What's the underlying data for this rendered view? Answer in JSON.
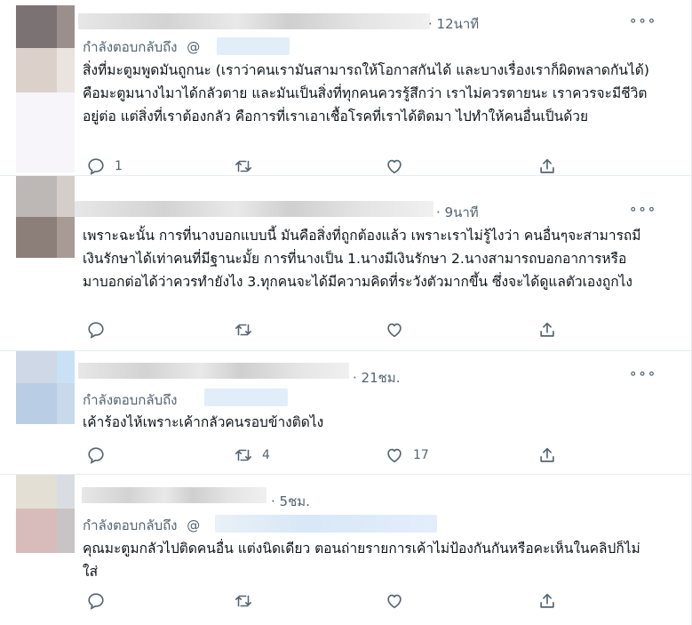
{
  "tweets": [
    {
      "time": "· 12นาที",
      "reply_label": "กำลังตอบกลับถึง",
      "reply_mention": "@",
      "text": "สิ่งที่มะตูมพูดมันถูกนะ (เราว่าคนเรามันสามารถให้โอกาสกันได้ และบางเรื่องเราก็ผิดพลาดกันได้) คือมะตูมนางไมาได้กลัวตาย และมันเป็นสิ่งที่ทุกคนควรรู้สึกว่า เราไม่ควรตายนะ เราควรจะมีชีวิตอยู่ต่อ แต่สิ่งที่เราต้องกลัว คือการที่เราเอาเชื้อโรคที่เราได้ติดมา ไปทำให้คนอื่นเป็นด้วย",
      "reply_count": "1",
      "retweet_count": "",
      "like_count": ""
    },
    {
      "time": "· 9นาที",
      "reply_label": "",
      "reply_mention": "",
      "text": "เพราะฉะนั้น การที่นางบอกแบบนี้ มันคือสิ่งที่ถูกต้องแล้ว เพราะเราไม่รู้ไงว่า คนอื่นๆจะสามารถมีเงินรักษาได้เท่าคนที่มีฐานะมั้ย การที่นางเป็น 1.นางมีเงินรักษา 2.นางสามารถบอกอาการหรือมาบอกต่อได้ว่าควรทำยังไง 3.ทุกคนจะได้มีความคิดที่ระวังตัวมากขึ้น ซึ่งจะได้ดูแลตัวเองถูกไง",
      "reply_count": "",
      "retweet_count": "",
      "like_count": ""
    },
    {
      "time": "· 21ชม.",
      "reply_label": "กำลังตอบกลับถึง",
      "reply_mention": "",
      "text": "เค้าร้องไห้เพราะเค้ากลัวคนรอบข้างติดไง",
      "reply_count": "",
      "retweet_count": "4",
      "like_count": "17"
    },
    {
      "time": "· 5ชม.",
      "reply_label": "กำลังตอบกลับถึง",
      "reply_mention": "@",
      "text": "คุณมะตูมกลัวไปติดคนอื่น แต่งนิดเดียว ตอนถ่ายรายการเค้าไม่ป้องกันกันหรือคะเห็นในคลิปก็ไม่ใส่",
      "reply_count": "",
      "retweet_count": "",
      "like_count": ""
    }
  ],
  "colors": {
    "text": "#0f1419",
    "muted": "#536471",
    "divider": "#e6ecf0",
    "mention_blur": "#e1eef9"
  },
  "icons": {
    "reply": "reply-icon",
    "retweet": "retweet-icon",
    "like": "heart-icon",
    "share": "share-icon",
    "more": "more-icon"
  }
}
